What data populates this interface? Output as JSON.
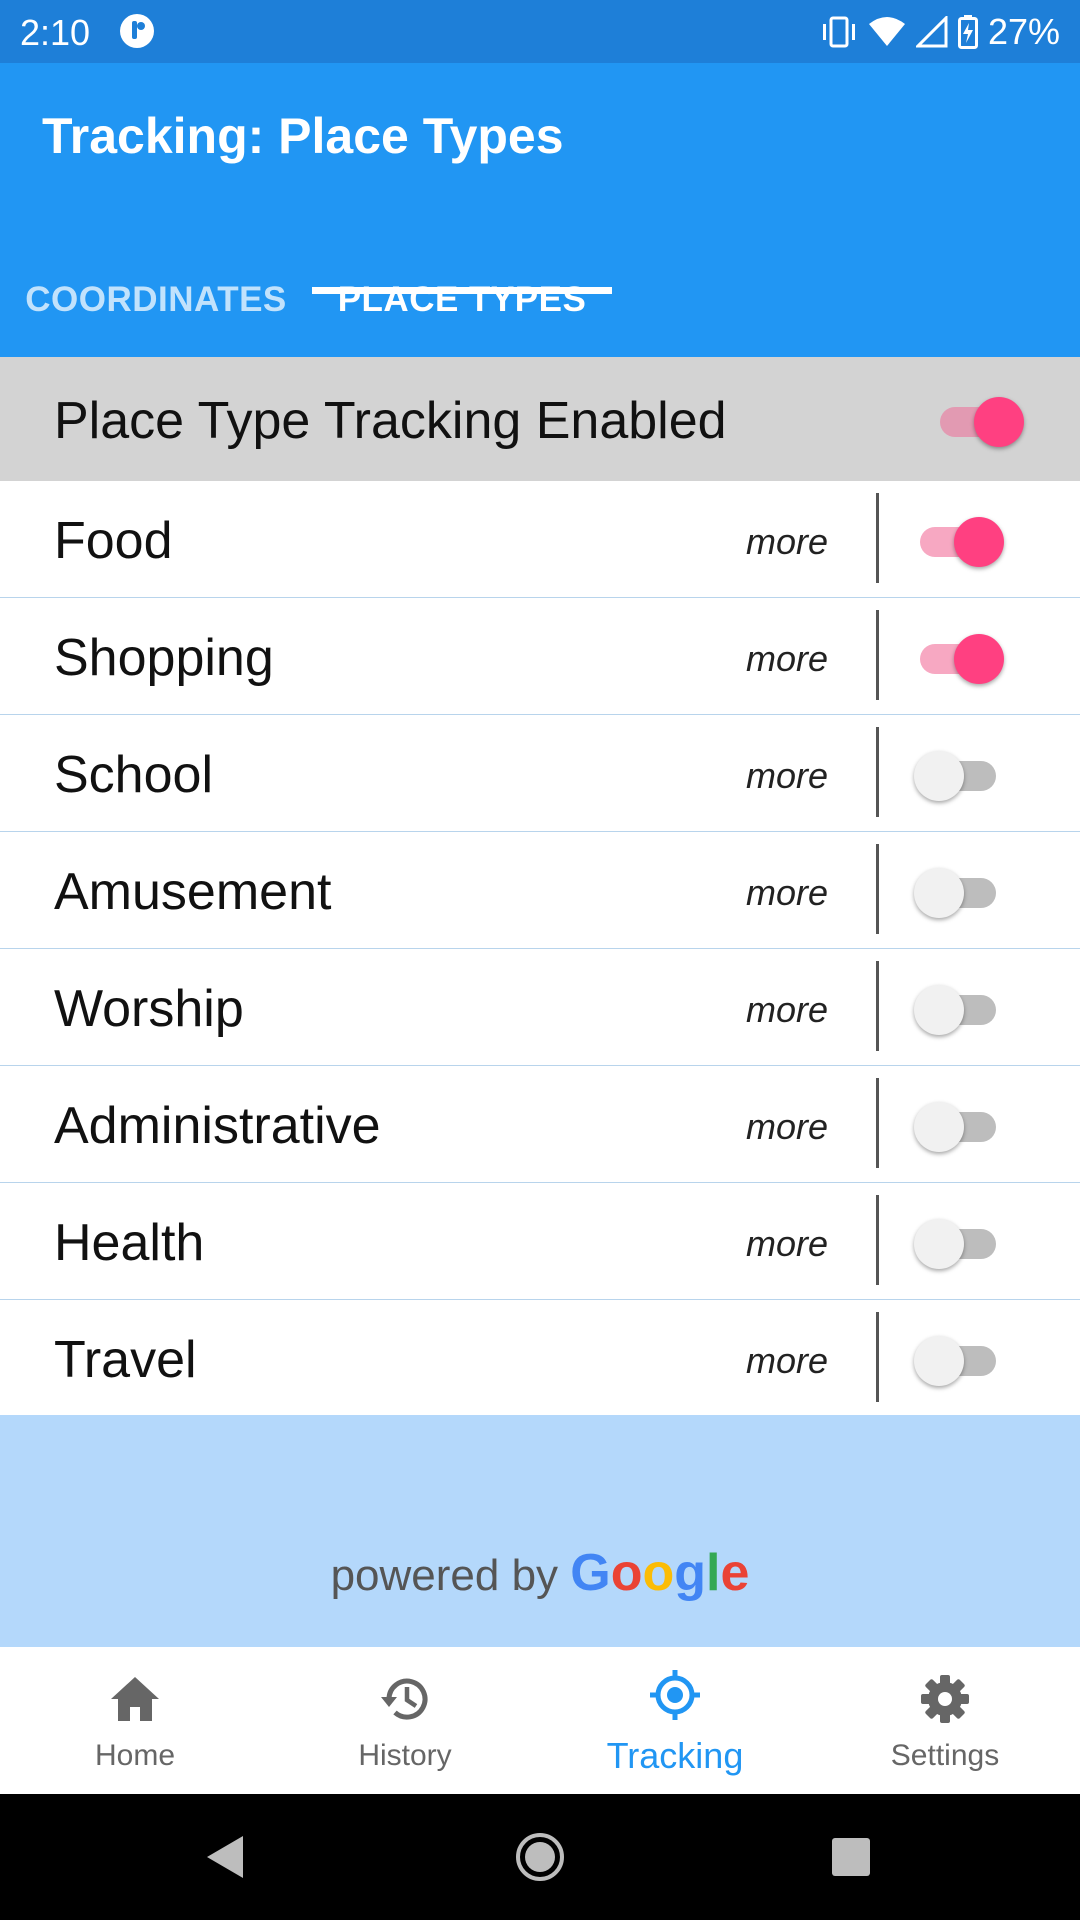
{
  "status_bar": {
    "time": "2:10",
    "battery": "27%"
  },
  "app_bar": {
    "title": "Tracking: Place Types"
  },
  "tabs": [
    {
      "label": "COORDINATES",
      "active": false
    },
    {
      "label": "PLACE TYPES",
      "active": true
    }
  ],
  "master_toggle": {
    "label": "Place Type Tracking Enabled",
    "on": true
  },
  "place_types": [
    {
      "label": "Food",
      "more": "more",
      "on": true
    },
    {
      "label": "Shopping",
      "more": "more",
      "on": true
    },
    {
      "label": "School",
      "more": "more",
      "on": false
    },
    {
      "label": "Amusement",
      "more": "more",
      "on": false
    },
    {
      "label": "Worship",
      "more": "more",
      "on": false
    },
    {
      "label": "Administrative",
      "more": "more",
      "on": false
    },
    {
      "label": "Health",
      "more": "more",
      "on": false
    },
    {
      "label": "Travel",
      "more": "more",
      "on": false
    }
  ],
  "attribution": {
    "prefix": "powered by",
    "brand_letters": [
      "G",
      "o",
      "o",
      "g",
      "l",
      "e"
    ]
  },
  "bottom_nav": [
    {
      "label": "Home",
      "icon": "home-icon",
      "active": false
    },
    {
      "label": "History",
      "icon": "history-icon",
      "active": false
    },
    {
      "label": "Tracking",
      "icon": "gps-target-icon",
      "active": true
    },
    {
      "label": "Settings",
      "icon": "gear-icon",
      "active": false
    }
  ],
  "colors": {
    "status_bar": "#1E7FD8",
    "app_bar": "#2196F3",
    "accent_pink": "#FF4081",
    "attribution_bg": "#B4D8FB",
    "active_nav": "#2196F3"
  }
}
